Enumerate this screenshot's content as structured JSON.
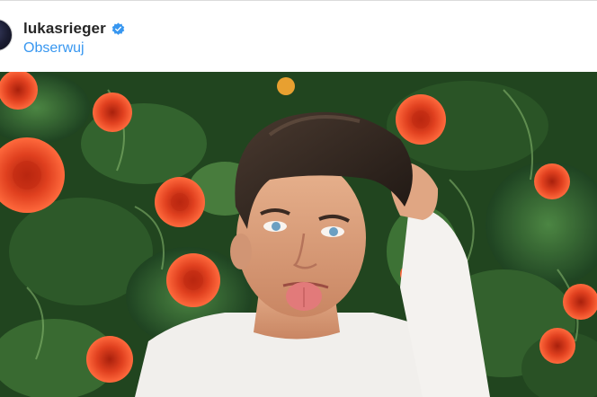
{
  "post": {
    "username": "lukasrieger",
    "follow_label": "Obserwuj",
    "verified": true
  },
  "icons": {
    "verified": "verified-badge-icon",
    "avatar": "profile-avatar"
  },
  "colors": {
    "link": "#3897f0",
    "verified_badge": "#3897f0",
    "username": "#262626",
    "divider": "#dbdbdb"
  }
}
